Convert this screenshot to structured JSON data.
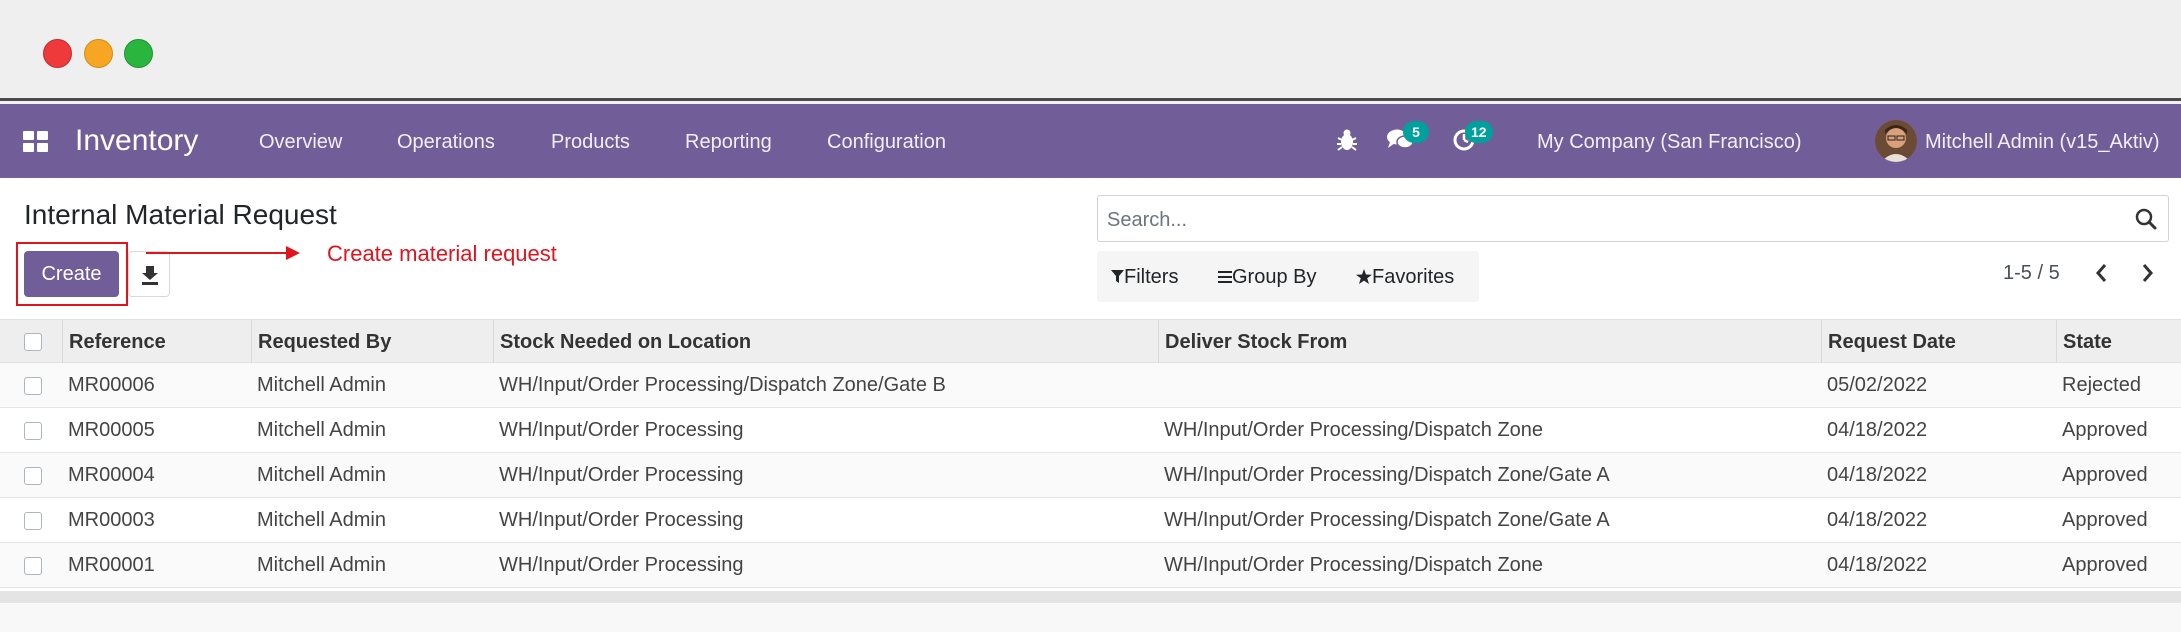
{
  "navbar": {
    "brand": "Inventory",
    "menu": [
      "Overview",
      "Operations",
      "Products",
      "Reporting",
      "Configuration"
    ],
    "messages_count": "5",
    "activities_count": "12",
    "company": "My Company (San Francisco)",
    "user": "Mitchell Admin (v15_Aktiv)",
    "accent_color": "#715d97",
    "badge_color": "#00a09d"
  },
  "control": {
    "title": "Internal Material Request",
    "create_label": "Create",
    "annotation": "Create material request",
    "annotation_color": "#e1141e",
    "search_placeholder": "Search...",
    "filters_label": "Filters",
    "groupby_label": "Group By",
    "favorites_label": "Favorites",
    "pager": "1-5 / 5"
  },
  "table": {
    "columns": [
      "Reference",
      "Requested By",
      "Stock Needed on Location",
      "Deliver Stock From",
      "Request Date",
      "State"
    ],
    "rows": [
      [
        "MR00006",
        "Mitchell Admin",
        "WH/Input/Order Processing/Dispatch Zone/Gate B",
        "",
        "05/02/2022",
        "Rejected"
      ],
      [
        "MR00005",
        "Mitchell Admin",
        "WH/Input/Order Processing",
        "WH/Input/Order Processing/Dispatch Zone",
        "04/18/2022",
        "Approved"
      ],
      [
        "MR00004",
        "Mitchell Admin",
        "WH/Input/Order Processing",
        "WH/Input/Order Processing/Dispatch Zone/Gate A",
        "04/18/2022",
        "Approved"
      ],
      [
        "MR00003",
        "Mitchell Admin",
        "WH/Input/Order Processing",
        "WH/Input/Order Processing/Dispatch Zone/Gate A",
        "04/18/2022",
        "Approved"
      ],
      [
        "MR00001",
        "Mitchell Admin",
        "WH/Input/Order Processing",
        "WH/Input/Order Processing/Dispatch Zone",
        "04/18/2022",
        "Approved"
      ]
    ]
  }
}
